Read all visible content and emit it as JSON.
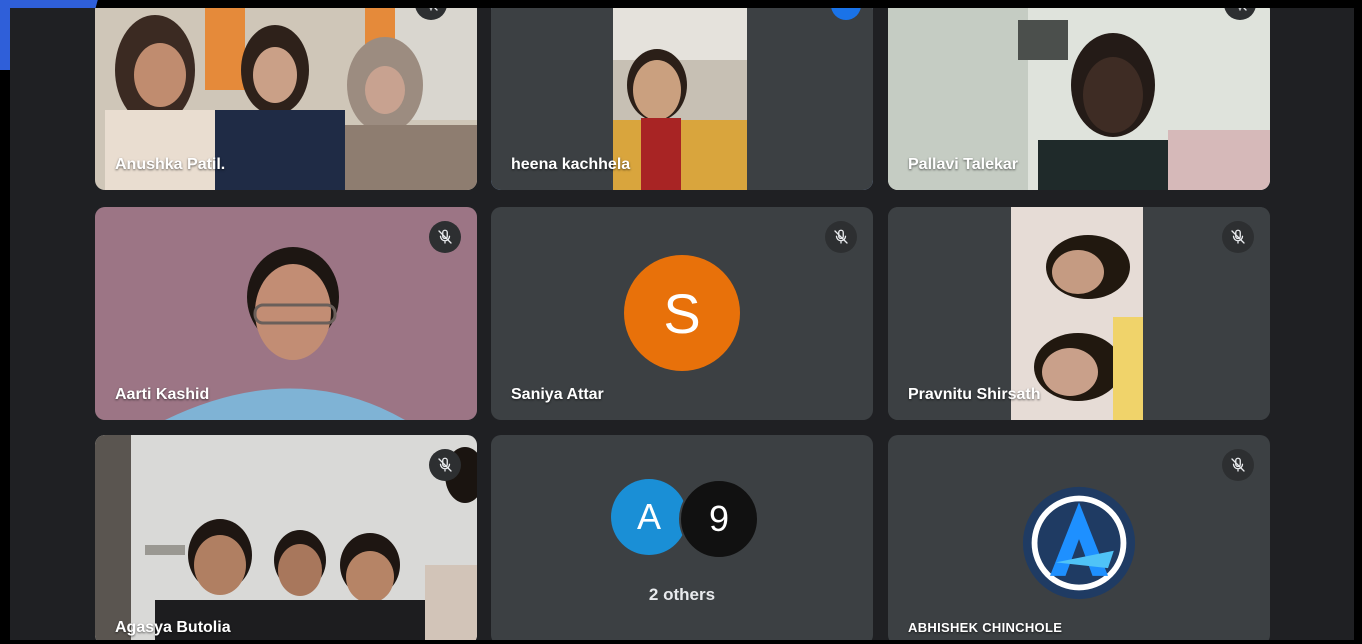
{
  "participants": [
    {
      "name": "Anushka Patil.",
      "muted": true
    },
    {
      "name": "heena kachhela",
      "muted": false,
      "speaking": true
    },
    {
      "name": "Pallavi Talekar",
      "muted": true
    },
    {
      "name": "Aarti Kashid",
      "muted": true
    },
    {
      "name": "Saniya Attar",
      "muted": true,
      "avatar_letter": "S",
      "avatar_color": "#e8710a"
    },
    {
      "name": "Pravnitu Shirsath",
      "muted": true
    },
    {
      "name": "Agasya Butolia",
      "muted": true
    },
    {
      "name": "ABHISHEK CHINCHOLE",
      "muted": true
    }
  ],
  "others": {
    "label": "2 others",
    "avatars": [
      {
        "letter": "A",
        "color": "#1a8fd6"
      },
      {
        "letter": "9",
        "color": "#111111"
      }
    ]
  },
  "icons": {
    "mute": "mic-off-icon",
    "logo": "abhishek-a-logo-icon"
  },
  "colors": {
    "stage_bg": "#1f2023",
    "tile_bg": "#3c4043",
    "active_border": "#8ab4f8",
    "accent": "#2f5fd9"
  }
}
